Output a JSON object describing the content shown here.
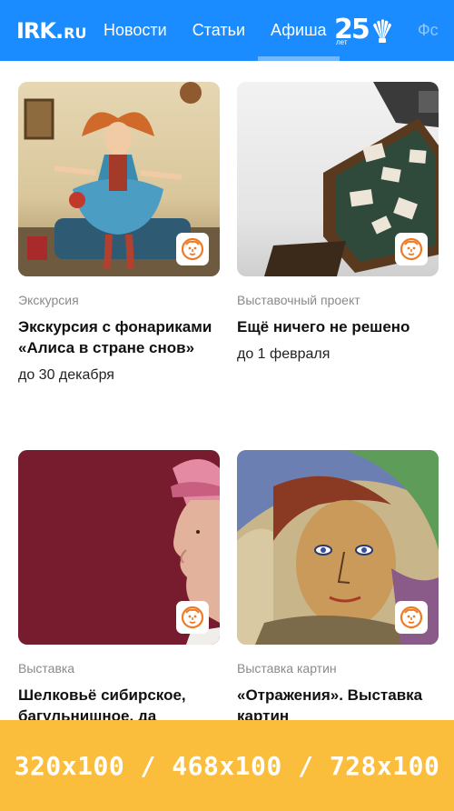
{
  "header": {
    "logo_main": "IRK",
    "logo_dot": ".",
    "logo_tld": "RU",
    "nav": [
      {
        "label": "Новости"
      },
      {
        "label": "Статьи"
      },
      {
        "label": "Афиша"
      }
    ],
    "active_nav": "Афиша",
    "anniversary_number": "25",
    "anniversary_word": "лет",
    "nav_cut_label": "Фс"
  },
  "cards": [
    {
      "category": "Экскурсия",
      "title": "Экскурсия с фонариками «Алиса в стране снов»",
      "date": "до 30 декабря",
      "icon": "lion-icon"
    },
    {
      "category": "Выставочный проект",
      "title": "Ещё ничего не решено",
      "date": "до 1 февраля",
      "icon": "lion-icon"
    },
    {
      "category": "Выставка",
      "title": "Шелковьё сибирское, багульнишное, да",
      "icon": "lion-icon"
    },
    {
      "category": "Выставка картин",
      "title": "«Отражения». Выставка картин",
      "icon": "lion-icon"
    }
  ],
  "ad": {
    "text": "320x100 / 468x100 / 728x100"
  },
  "colors": {
    "header_bg": "#1a8cff",
    "ad_bg": "#fbbd3c",
    "lion_orange": "#f07a22"
  }
}
